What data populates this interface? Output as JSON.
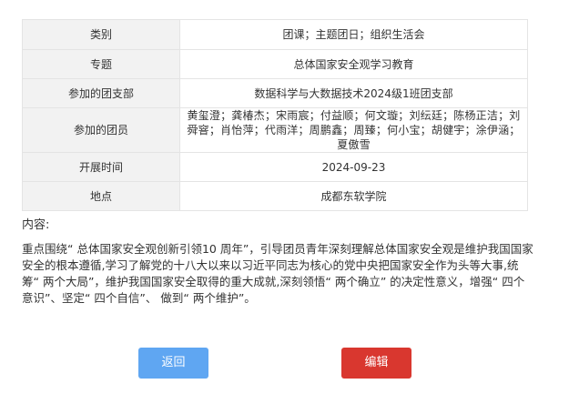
{
  "details": {
    "rows": [
      {
        "label": "类别",
        "value": "团课；主题团日；组织生活会"
      },
      {
        "label": "专题",
        "value": "总体国家安全观学习教育"
      },
      {
        "label": "参加的团支部",
        "value": "数据科学与大数据技术2024级1班团支部"
      },
      {
        "label": "参加的团员",
        "value": "黄玺澄；龚椿杰；宋雨宸；付益顺；何文璇；刘纭廷；陈杨正洁；刘舜窨；肖怡萍；代雨洋；周鹏鑫；周臻；何小宝；胡健宇；涂伊涵；夏傲雪"
      },
      {
        "label": "开展时间",
        "value": "2024-09-23"
      },
      {
        "label": "地点",
        "value": "成都东软学院"
      }
    ]
  },
  "content": {
    "label": "内容:",
    "text": "重点围绕“ 总体国家安全观创新引领10 周年”，引导团员青年深刻理解总体国家安全观是维护我国国家安全的根本遵循,学习了解党的十八大以来以习近平同志为核心的党中央把国家安全作为头等大事,统筹“ 两个大局”，维护我国国家安全取得的重大成就,深刻领悟“ 两个确立” 的决定性意义，增强“ 四个意识”、坚定“ 四个自信”、 做到“ 两个维护”。"
  },
  "buttons": {
    "back_label": "返回",
    "edit_label": "编辑"
  },
  "colors": {
    "back_button": "#5fa6f2",
    "edit_button": "#d9372f",
    "label_cell_bg": "#f2f2f2",
    "border": "#e4e4e4"
  }
}
